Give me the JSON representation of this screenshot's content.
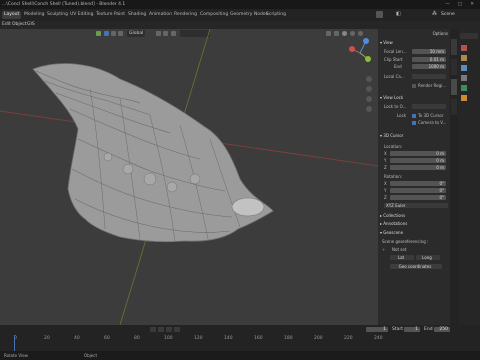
{
  "window": {
    "title": "...\\Concl Shell\\Conch Shell (Tuned).blend] - Blender 4.1"
  },
  "workspaces": [
    "Layout",
    "Modeling",
    "Sculpting",
    "UV Editing",
    "Texture Paint",
    "Shading",
    "Animation",
    "Rendering",
    "Compositing",
    "Geometry Nodes",
    "Scripting"
  ],
  "scene_label": "Scene",
  "menu": [
    "Edit",
    "Object",
    "GIS"
  ],
  "viewport": {
    "mode_label": "Global",
    "options_label": "Options"
  },
  "npanel": {
    "view_title": "View",
    "focal_length": {
      "label": "Focal Len...",
      "value": "50 mm"
    },
    "clip_start": {
      "label": "Clip Start",
      "value": "0.01 m"
    },
    "clip_end": {
      "label": "End",
      "value": "1000 m"
    },
    "local_camera": {
      "label": "Local Ca..."
    },
    "render_region": {
      "label": "Render Regi..."
    },
    "view_lock_title": "View Lock",
    "lock_to_object": {
      "label": "Lock to O..."
    },
    "lock_label": "Lock",
    "to_3d_cursor": "To 3D Cursor",
    "camera_to_view": "Camera to V...",
    "cursor_title": "3D Cursor",
    "location_label": "Location:",
    "x": {
      "label": "X",
      "value": "0 m"
    },
    "y": {
      "label": "Y",
      "value": "0 m"
    },
    "z": {
      "label": "Z",
      "value": "0 m"
    },
    "rotation_label": "Rotation:",
    "rx": {
      "label": "X",
      "value": "0°"
    },
    "ry": {
      "label": "Y",
      "value": "0°"
    },
    "rz": {
      "label": "Z",
      "value": "0°"
    },
    "rotation_mode": "XYZ Euler",
    "collections_title": "Collections",
    "annotations_title": "Annotations",
    "geoscene_title": "Geoscene",
    "geo_georef_label": "Scene georeferencing :",
    "geo_not_set": "Not set",
    "geo_lat": "Lat",
    "geo_long": "Long",
    "geo_button": "Geo coordinates"
  },
  "timeline": {
    "frame_current": "1",
    "start_label": "Start",
    "start": "1",
    "end_label": "End",
    "end": "250",
    "ticks": [
      "0",
      "20",
      "40",
      "60",
      "80",
      "100",
      "120",
      "140",
      "160",
      "180",
      "200",
      "220",
      "240"
    ]
  },
  "statusbar": {
    "left": "Rotate View",
    "mid": "Object"
  },
  "colors": {
    "accent": "#4772b3",
    "x_axis": "#c8524f",
    "y_axis": "#8bbd3b",
    "z_axis": "#4f8ce0"
  }
}
